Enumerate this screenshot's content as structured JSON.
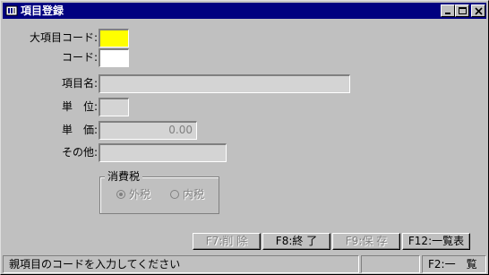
{
  "window": {
    "title": "項目登録",
    "controls": [
      "minimize-icon",
      "maximize-icon",
      "close-icon"
    ]
  },
  "form": {
    "major_code": {
      "label": "大項目コード:",
      "value": ""
    },
    "code": {
      "label": "コード:",
      "value": ""
    },
    "item_name": {
      "label": "項目名:",
      "value": ""
    },
    "unit": {
      "label": "単　位:",
      "value": ""
    },
    "price": {
      "label": "単　価:",
      "value": "0.00"
    },
    "other": {
      "label": "その他:",
      "value": ""
    }
  },
  "tax": {
    "group_label": "消費税",
    "options": [
      "外税",
      "内税"
    ],
    "selected": "外税"
  },
  "buttons": {
    "delete": "F7:削 除",
    "exit": "F8:終 了",
    "save": "F9:保 存",
    "list": "F12:一覧表"
  },
  "status": {
    "message": "親項目のコードを入力してください",
    "hint": "F2:一　覧"
  },
  "colors": {
    "title_bar": "#000080",
    "focused_field": "#ffff00",
    "face": "#c0c0c0",
    "disabled_field": "#d4d4d4"
  }
}
